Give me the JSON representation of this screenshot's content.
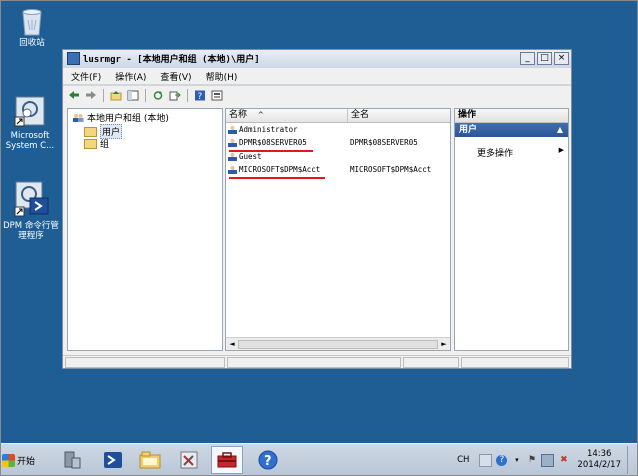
{
  "desktop": {
    "icons": [
      {
        "label": "回收站",
        "icon": "recycle-bin-icon"
      },
      {
        "label_line1": "Microsoft",
        "label_line2": "System C...",
        "icon": "mmc-shortcut-icon"
      },
      {
        "label_line1": "DPM 命令行管",
        "label_line2": "理程序",
        "icon": "powershell-shortcut-icon"
      }
    ]
  },
  "window": {
    "title": "lusrmgr - [本地用户和组 (本地)\\用户]",
    "controls": {
      "minimize": "_",
      "maximize": "□",
      "close": "×"
    },
    "menu": [
      "文件(F)",
      "操作(A)",
      "查看(V)",
      "帮助(H)"
    ],
    "toolbar": [
      "back-arrow-icon",
      "forward-arrow-icon",
      "up-folder-icon",
      "show-tree-icon",
      "refresh-icon",
      "export-icon",
      "help-icon",
      "properties-icon"
    ]
  },
  "tree": {
    "root": "本地用户和组 (本地)",
    "children": [
      "用户",
      "组"
    ],
    "selected": "用户"
  },
  "list": {
    "columns": [
      "名称",
      "全名"
    ],
    "sort_indicator": "^",
    "rows": [
      {
        "name": "Administrator",
        "fullname": ""
      },
      {
        "name": "DPMR$08SERVER05",
        "fullname": "DPMR$08SERVER05"
      },
      {
        "name": "Guest",
        "fullname": ""
      },
      {
        "name": "MICROSOFT$DPM$Acct",
        "fullname": "MICROSOFT$DPM$Acct"
      }
    ],
    "scroll_left": "◄",
    "scroll_right": "►"
  },
  "actions": {
    "title": "操作",
    "section": "用户",
    "more": "更多操作",
    "more_arrow": "▶",
    "collapse": "▲"
  },
  "taskbar": {
    "start_label": "开始",
    "programs": [
      "server-manager-icon",
      "powershell-icon",
      "explorer-folder-icon",
      "tools-icon",
      "lusrmgr-toolbox-icon",
      "help-icon"
    ],
    "active_program": "lusrmgr-toolbox-icon",
    "lang": "CH",
    "time": "14:36",
    "date": "2014/2/17"
  },
  "colors": {
    "desktop": "#1f5e94",
    "action_header": "#2b5595",
    "annotation_underline": "#e0191a"
  }
}
